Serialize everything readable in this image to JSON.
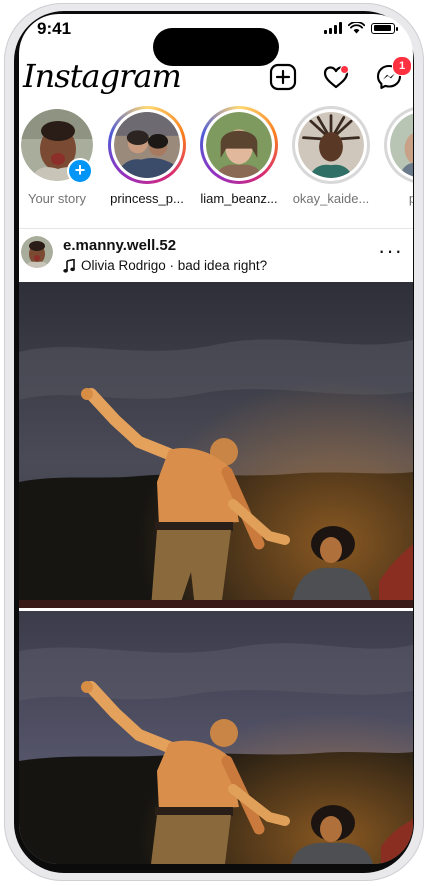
{
  "status_bar": {
    "time": "9:41"
  },
  "app": {
    "logo": "Instagram",
    "notifications_badge": "1"
  },
  "stories": [
    {
      "label": "Your story",
      "ring": "none",
      "own": true
    },
    {
      "label": "princess_p...",
      "ring": "grad"
    },
    {
      "label": "liam_beanz...",
      "ring": "grad"
    },
    {
      "label": "okay_kaide...",
      "ring": "seen"
    },
    {
      "label": "pia...",
      "ring": "seen"
    }
  ],
  "post": {
    "username": "e.manny.well.52",
    "song": "Olivia Rodrigo · bad idea right?"
  },
  "colors": {
    "accent_blue": "#0095f6",
    "notification_red": "#ff3040",
    "night_sky": "#3b3b46",
    "fire_glow": "#f0a04a"
  }
}
